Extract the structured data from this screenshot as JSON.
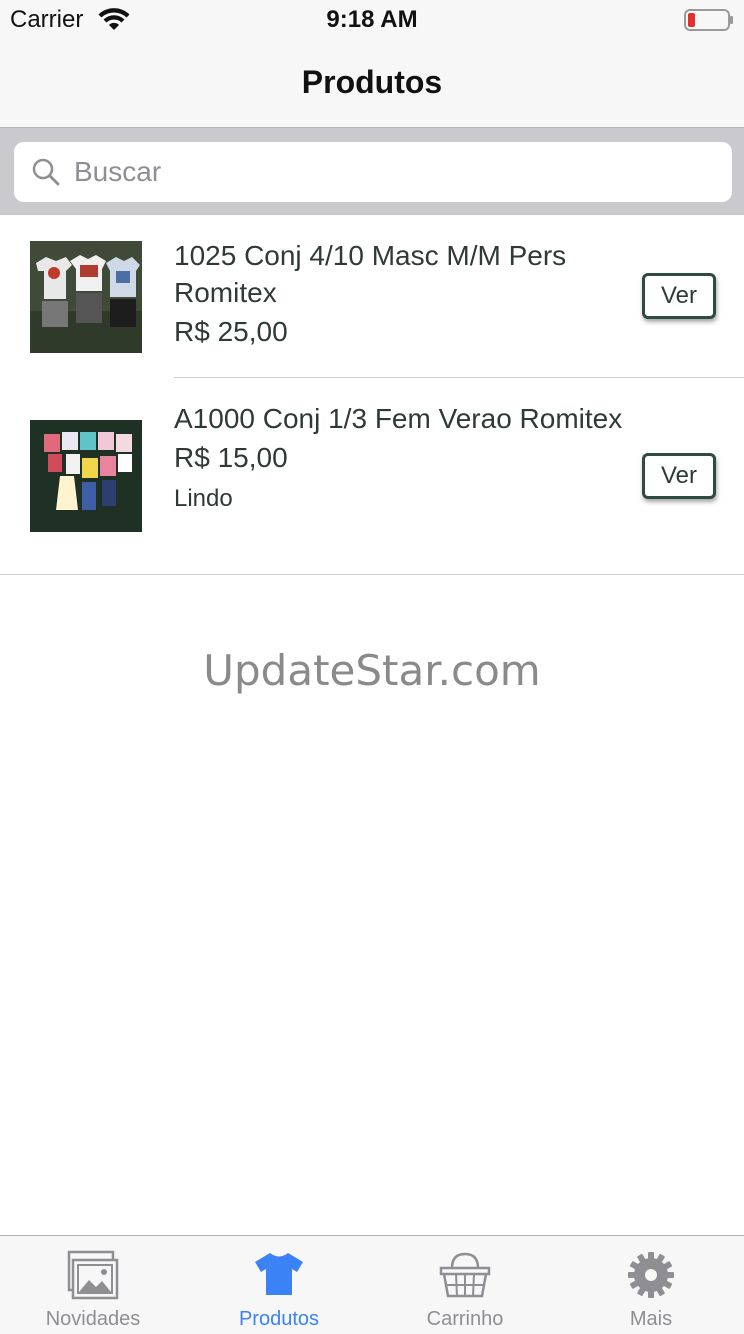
{
  "status_bar": {
    "carrier": "Carrier",
    "time": "9:18 AM"
  },
  "nav": {
    "title": "Produtos"
  },
  "search": {
    "placeholder": "Buscar",
    "value": ""
  },
  "products": [
    {
      "name": "1025 Conj 4/10 Masc M/M Pers Romitex",
      "price": "R$ 25,00",
      "note": "",
      "button_label": "Ver"
    },
    {
      "name": "A1000 Conj 1/3 Fem Verao Romitex",
      "price": "R$ 15,00",
      "note": "Lindo",
      "button_label": "Ver"
    }
  ],
  "watermark": "UpdateStar.com",
  "tabs": [
    {
      "label": "Novidades",
      "icon": "photos-icon",
      "active": false
    },
    {
      "label": "Produtos",
      "icon": "tshirt-icon",
      "active": true
    },
    {
      "label": "Carrinho",
      "icon": "basket-icon",
      "active": false
    },
    {
      "label": "Mais",
      "icon": "gear-icon",
      "active": false
    }
  ],
  "colors": {
    "tab_active": "#3b82f6",
    "tab_inactive": "#8e8e93",
    "button_border": "#2f4a40",
    "battery_low": "#e0312a"
  }
}
